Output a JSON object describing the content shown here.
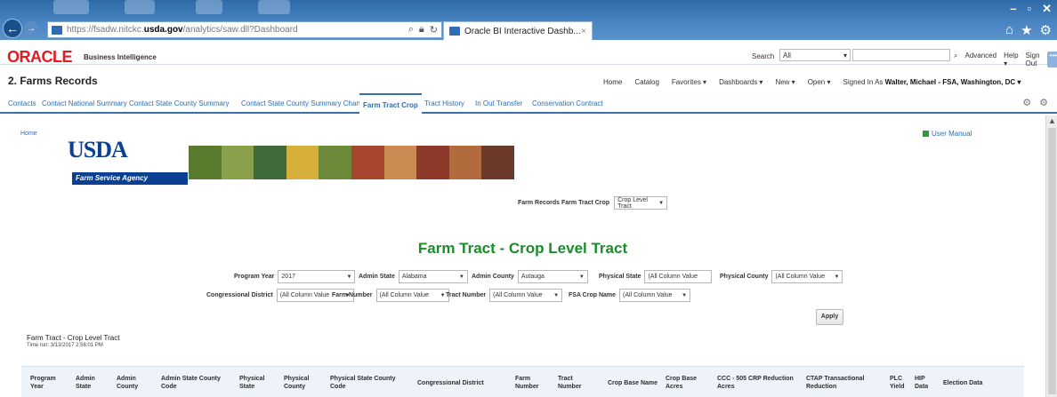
{
  "browser": {
    "url_prefix": "https://fsadw.nitckc.",
    "url_domain": "usda.gov",
    "url_path": "/analytics/saw.dll?Dashboard",
    "tab_title": "Oracle BI Interactive Dashb...",
    "tab_close": "×"
  },
  "oracle": {
    "logo": "ORACLE",
    "product": "Business Intelligence",
    "search_label": "Search",
    "search_scope": "All",
    "advanced": "Advanced",
    "help": "Help ▾",
    "sign_out": "Sign Out",
    "more": "•••"
  },
  "dashboard": {
    "title": "2. Farms Records",
    "menu": {
      "home": "Home",
      "catalog": "Catalog",
      "favorites": "Favorites ▾",
      "dashboards": "Dashboards ▾",
      "new": "New ▾",
      "open": "Open ▾",
      "signed_in_as": "Signed In As",
      "user": "Walter, Michael - FSA, Washington, DC ▾"
    },
    "tabs": [
      "Contacts",
      "Contact National Summary",
      "Contact State County Summary",
      "Contact State County Summary Chart",
      "Farm Tract Crop",
      "Tract History",
      "In Out Transfer",
      "Conservation Contract"
    ],
    "active_tab": "Farm Tract Crop"
  },
  "content": {
    "home_link": "Home",
    "usda_logo": "USDA",
    "agency": "Farm Service Agency",
    "user_manual": "User Manual",
    "frtc_label": "Farm Records Farm Tract Crop",
    "frtc_value": "Crop Level Tract",
    "main_title": "Farm Tract - Crop Level Tract",
    "prompts": {
      "program_year": {
        "label": "Program Year",
        "value": "2017"
      },
      "admin_state": {
        "label": "Admin State",
        "value": "Alabama"
      },
      "admin_county": {
        "label": "Admin County",
        "value": "Autauga"
      },
      "physical_state": {
        "label": "Physical State",
        "value": "(All Column Value"
      },
      "physical_county": {
        "label": "Physical County",
        "value": "(All Column Value"
      },
      "congressional_district": {
        "label": "Congressional District",
        "value": "(All Column Value"
      },
      "farm_number": {
        "label": "Farm Number",
        "value": "(All Column Value"
      },
      "tract_number": {
        "label": "Tract Number",
        "value": "(All Column Value"
      },
      "fsa_crop_name": {
        "label": "FSA Crop Name",
        "value": "(All Column Value"
      }
    },
    "apply": "Apply",
    "report_title": "Farm Tract - Crop Level Tract",
    "report_time": "Time run: 3/13/2017 2:56:01 PM"
  },
  "table": {
    "headers": [
      "Program Year",
      "Admin State",
      "Admin County",
      "Admin State County Code",
      "Physical State",
      "Physical County",
      "Physical State County Code",
      "Congressional District",
      "Farm Number",
      "Tract Number",
      "Crop Base Name",
      "Crop Base Acres",
      "CCC - 505 CRP Reduction Acres",
      "CTAP Transactional Reduction",
      "PLC Yield",
      "HIP Data",
      "Election Data"
    ]
  },
  "colors": {
    "oracle_red": "#e31b23",
    "title_green": "#1d8a2c",
    "link_blue": "#2e6db4",
    "usda_blue": "#0b3f91"
  }
}
